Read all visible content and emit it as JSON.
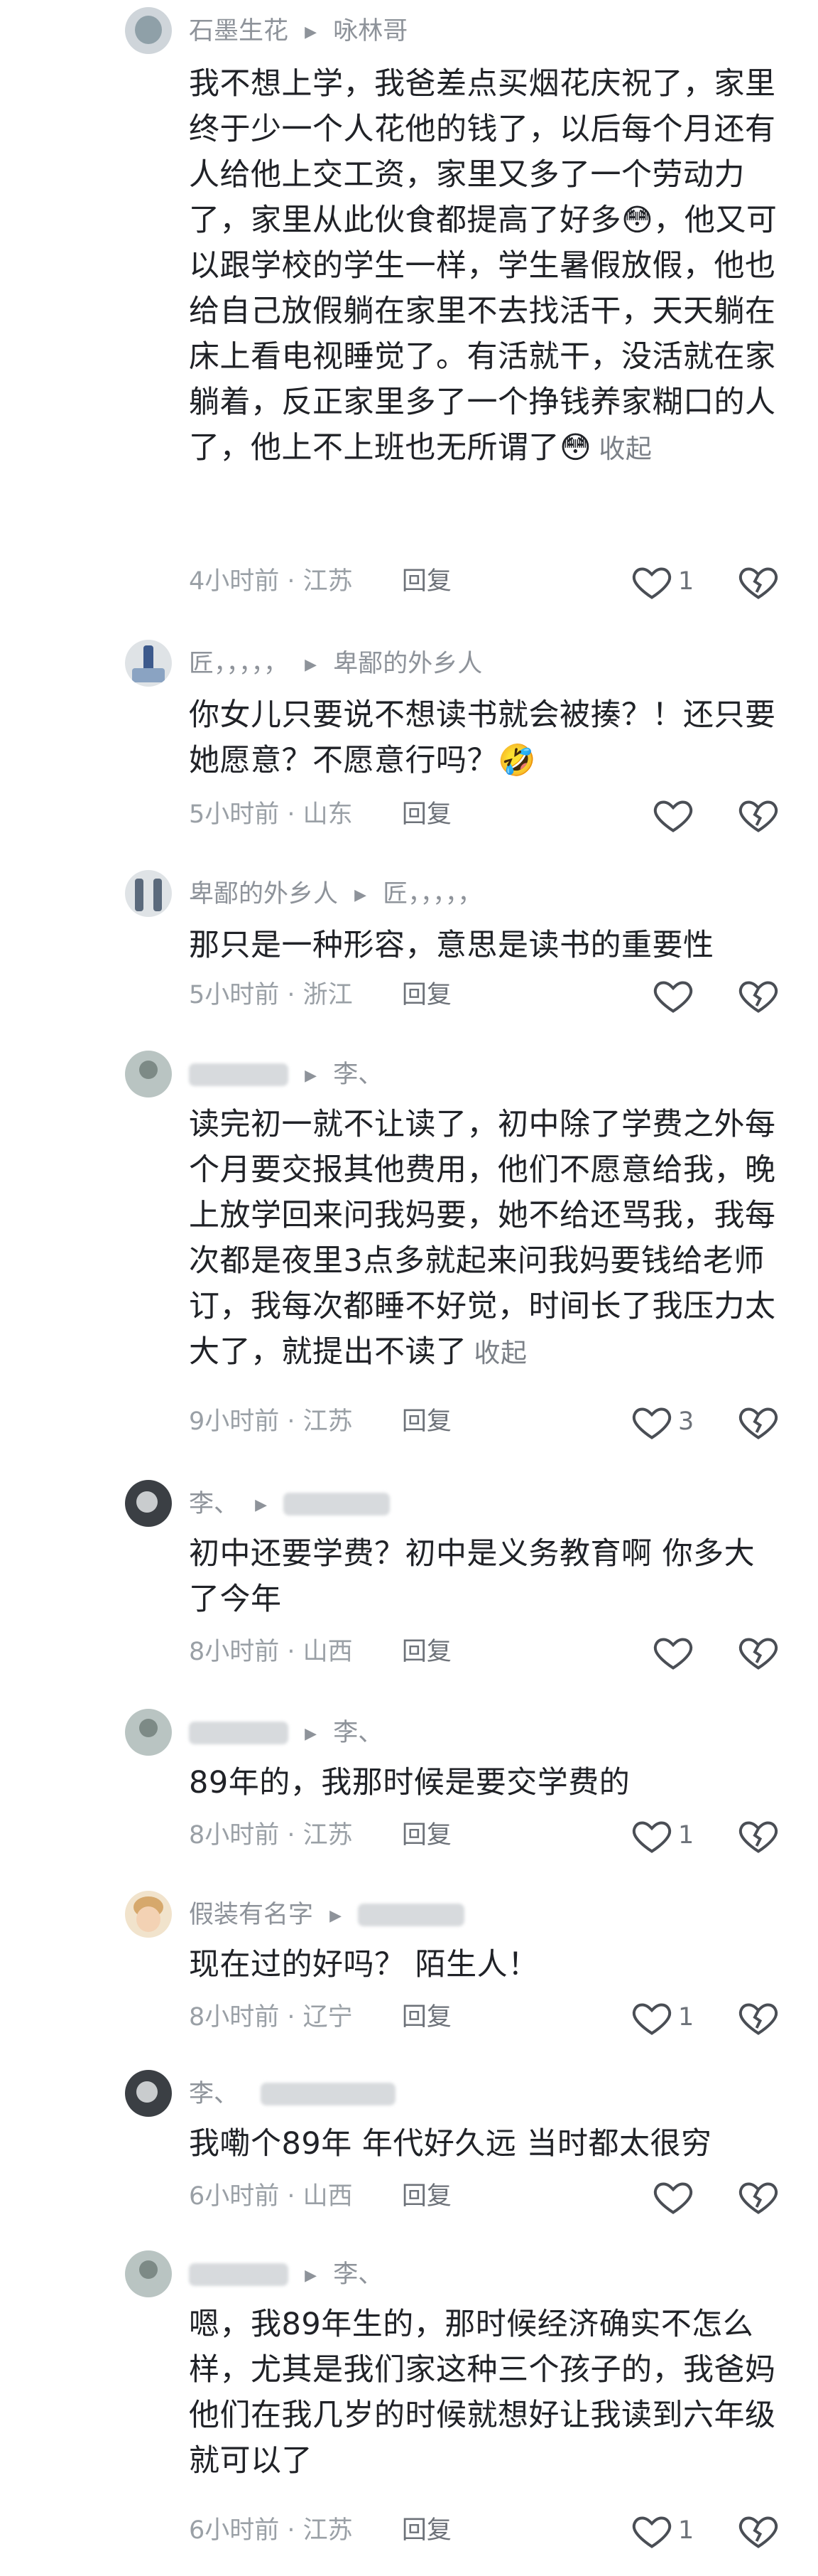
{
  "comments": [
    {
      "author": "石墨生花",
      "reply_to": "咏林哥",
      "text": "我不想上学，我爸差点买烟花庆祝了，家里终于少一个人花他的钱了，以后每个月还有人给他上交工资，家里又多了一个劳动力了，家里从此伙食都提高了好多😳，他又可以跟学校的学生一样，学生暑假放假，他也给自己放假躺在家里不去找活干，天天躺在床上看电视睡觉了。有活就干，没活就在家躺着，反正家里多了一个挣钱养家糊口的人了，他上不上班也无所谓了😳",
      "fold": "收起",
      "time": "4小时前",
      "location": "江苏",
      "reply": "回复",
      "likes": "1"
    },
    {
      "author": "匠，，，，，",
      "reply_to": "卑鄙的外乡人",
      "text": "你女儿只要说不想读书就会被揍？！还只要她愿意？不愿意行吗？🤣",
      "time": "5小时前",
      "location": "山东",
      "reply": "回复",
      "likes": ""
    },
    {
      "author": "卑鄙的外乡人",
      "reply_to": "匠，，，，，",
      "text": "那只是一种形容，意思是读书的重要性",
      "time": "5小时前",
      "location": "浙江",
      "reply": "回复",
      "likes": ""
    },
    {
      "author": "",
      "reply_to": "李、",
      "text": "读完初一就不让读了，初中除了学费之外每个月要交报其他费用，他们不愿意给我，晚上放学回来问我妈要，她不给还骂我，我每次都是夜里3点多就起来问我妈要钱给老师订，我每次都睡不好觉，时间长了我压力太大了，就提出不读了",
      "fold": "收起",
      "time": "9小时前",
      "location": "江苏",
      "reply": "回复",
      "likes": "3"
    },
    {
      "author": "李、",
      "reply_to": "",
      "text": "初中还要学费？初中是义务教育啊  你多大了今年",
      "time": "8小时前",
      "location": "山西",
      "reply": "回复",
      "likes": ""
    },
    {
      "author": "",
      "reply_to": "李、",
      "text": "89年的，我那时候是要交学费的",
      "time": "8小时前",
      "location": "江苏",
      "reply": "回复",
      "likes": "1"
    },
    {
      "author": "假装有名字",
      "reply_to": "",
      "text": "现在过的好吗？  陌生人！",
      "time": "8小时前",
      "location": "辽宁",
      "reply": "回复",
      "likes": "1"
    },
    {
      "author": "李、",
      "reply_to": "",
      "text": "我嘞个89年    年代好久远    当时都太很穷",
      "time": "6小时前",
      "location": "山西",
      "reply": "回复",
      "likes": ""
    },
    {
      "author": "",
      "reply_to": "李、",
      "text": "嗯，我89年生的，那时候经济确实不怎么样，尤其是我们家这种三个孩子的，我爸妈他们在我几岁的时候就想好让我读到六年级就可以了",
      "time": "6小时前",
      "location": "江苏",
      "reply": "回复",
      "likes": "1"
    }
  ],
  "icons": {
    "like": "heart-outline-icon",
    "dislike": "broken-heart-icon",
    "arrow": "caret-right-icon"
  },
  "colors": {
    "text": "#202227",
    "meta": "#9aa0a6",
    "name": "#8e939a"
  }
}
